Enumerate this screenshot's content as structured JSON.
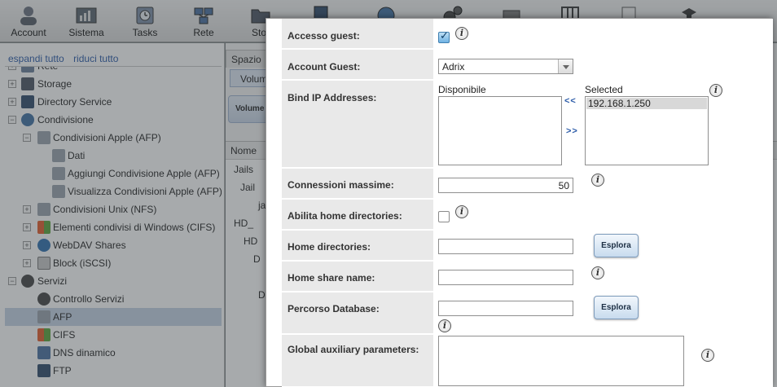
{
  "toolbar": {
    "items": [
      {
        "label": "Account",
        "icon": "account-icon"
      },
      {
        "label": "Sistema",
        "icon": "system-icon"
      },
      {
        "label": "Tasks",
        "icon": "tasks-icon"
      },
      {
        "label": "Rete",
        "icon": "network-icon"
      },
      {
        "label": "Stor",
        "icon": "storage-folder-icon"
      },
      {
        "label": "",
        "icon": "directory-icon"
      },
      {
        "label": "",
        "icon": "sharing-icon"
      },
      {
        "label": "",
        "icon": "services-icon"
      },
      {
        "label": "",
        "icon": "plugins-icon"
      },
      {
        "label": "",
        "icon": "jails-icon"
      },
      {
        "label": "",
        "icon": "reporting-icon"
      },
      {
        "label": "",
        "icon": "wizard-icon"
      }
    ]
  },
  "tree": {
    "expand_all": "espandi tutto",
    "collapse_all": "riduci tutto",
    "rows": [
      {
        "label": "Rete",
        "icon": "network-icon"
      },
      {
        "label": "Storage",
        "icon": "storage-icon"
      },
      {
        "label": "Directory Service",
        "icon": "directory-service-icon"
      },
      {
        "label": "Condivisione",
        "icon": "sharing-icon"
      },
      {
        "label": "Condivisioni Apple (AFP)",
        "icon": "apple-share-icon"
      },
      {
        "label": "Dati",
        "icon": "share-item-icon"
      },
      {
        "label": "Aggiungi Condivisione Apple (AFP)",
        "icon": "add-share-icon"
      },
      {
        "label": "Visualizza Condivisioni Apple (AFP)",
        "icon": "view-shares-icon"
      },
      {
        "label": "Condivisioni Unix (NFS)",
        "icon": "unix-share-icon"
      },
      {
        "label": "Elementi condivisi di Windows (CIFS)",
        "icon": "windows-share-icon"
      },
      {
        "label": "WebDAV Shares",
        "icon": "webdav-icon"
      },
      {
        "label": "Block (iSCSI)",
        "icon": "block-icon"
      },
      {
        "label": "Servizi",
        "icon": "services-icon"
      },
      {
        "label": "Controllo Servizi",
        "icon": "services-control-icon"
      },
      {
        "label": "AFP",
        "icon": "afp-icon"
      },
      {
        "label": "CIFS",
        "icon": "cifs-icon"
      },
      {
        "label": "DNS dinamico",
        "icon": "dns-icon"
      },
      {
        "label": "FTP",
        "icon": "ftp-icon"
      }
    ]
  },
  "middle": {
    "tab": "Spazio",
    "volume_tab": "Volum",
    "volume_button": "Volume",
    "grid_header": "Nome",
    "rows": [
      "Jails",
      "Jail",
      "ja",
      "HD_",
      "HD",
      "D",
      "D"
    ]
  },
  "dialog": {
    "guest_access": {
      "label": "Accesso guest:",
      "checked": true
    },
    "guest_account": {
      "label": "Account Guest:",
      "value": "Adrix"
    },
    "bind_ip": {
      "label": "Bind IP Addresses:",
      "available_label": "Disponibile",
      "selected_label": "Selected",
      "move_left": "<<",
      "move_right": ">>",
      "selected_items": [
        "192.168.1.250"
      ]
    },
    "max_connections": {
      "label": "Connessioni massime:",
      "value": "50"
    },
    "home_dirs_enabled": {
      "label": "Abilita home directories:",
      "checked": false
    },
    "home_dirs": {
      "label": "Home directories:",
      "value": "",
      "browse": "Esplora"
    },
    "home_share_name": {
      "label": "Home share name:",
      "value": ""
    },
    "db_path": {
      "label": "Percorso Database:",
      "value": "",
      "browse": "Esplora"
    },
    "aux_params": {
      "label": "Global auxiliary parameters:",
      "value": ""
    },
    "info_glyph": "i"
  }
}
